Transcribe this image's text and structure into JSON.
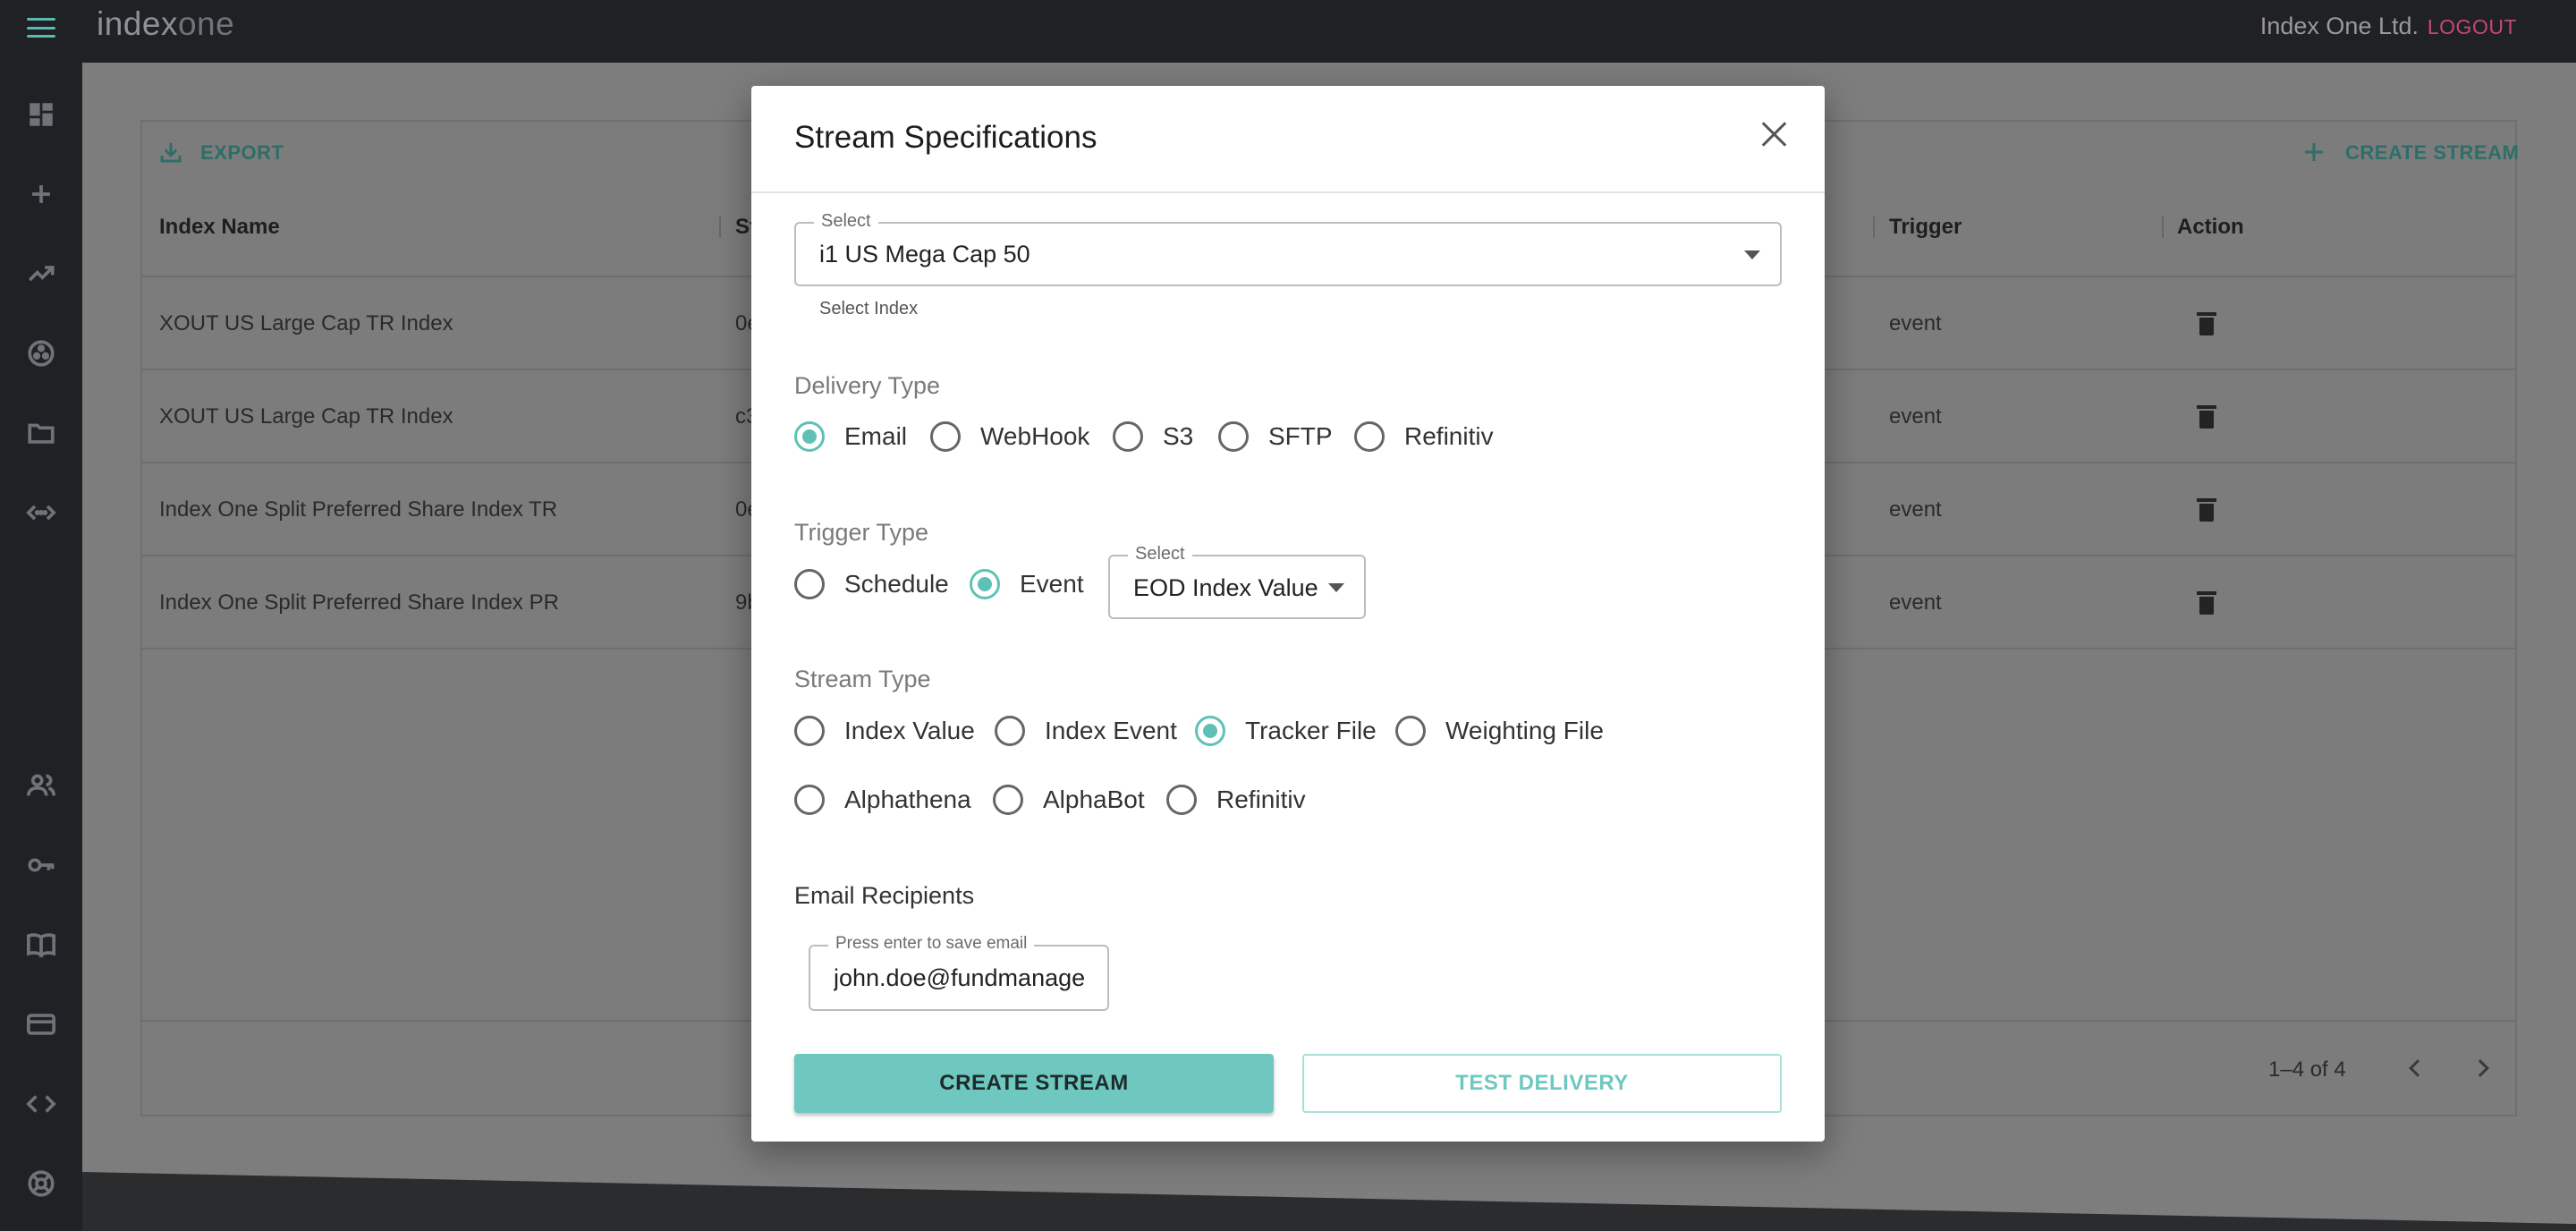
{
  "app": {
    "logo_part1": "index",
    "logo_part2": "one",
    "company": "Index One Ltd.",
    "logout": "LOGOUT"
  },
  "sidebar": {
    "icons": [
      "dashboard-icon",
      "plus-icon",
      "trending-up-icon",
      "hub-icon",
      "folder-icon",
      "api-icon",
      "people-icon",
      "key-icon",
      "book-icon",
      "card-icon",
      "code-icon",
      "support-icon"
    ]
  },
  "table": {
    "export_label": "EXPORT",
    "create_label": "CREATE STREAM",
    "headers": {
      "index_name": "Index Name",
      "stream": "St",
      "trigger": "Trigger",
      "action": "Action"
    },
    "rows": [
      {
        "name": "XOUT US Large Cap TR Index",
        "stream": "0e",
        "trigger": "event"
      },
      {
        "name": "XOUT US Large Cap TR Index",
        "stream": "c3",
        "trigger": "event"
      },
      {
        "name": "Index One Split Preferred Share Index TR",
        "stream": "0e",
        "trigger": "event"
      },
      {
        "name": "Index One Split Preferred Share Index PR",
        "stream": "9b",
        "trigger": "event"
      }
    ],
    "pagination": "1–4 of 4"
  },
  "modal": {
    "title": "Stream Specifications",
    "index_select": {
      "label": "Select",
      "value": "i1 US Mega Cap 50",
      "helper": "Select Index"
    },
    "delivery": {
      "label": "Delivery Type",
      "options": [
        "Email",
        "WebHook",
        "S3",
        "SFTP",
        "Refinitiv"
      ],
      "selected": "Email"
    },
    "trigger": {
      "label": "Trigger Type",
      "options": [
        "Schedule",
        "Event"
      ],
      "selected": "Event",
      "event_select": {
        "label": "Select",
        "value": "EOD Index Value"
      }
    },
    "stream_type": {
      "label": "Stream Type",
      "options": [
        "Index Value",
        "Index Event",
        "Tracker File",
        "Weighting File",
        "Alphathena",
        "AlphaBot",
        "Refinitiv"
      ],
      "selected": "Tracker File"
    },
    "email": {
      "label": "Email Recipients",
      "field_label": "Press enter to save email",
      "value": "john.doe@fundmanage"
    },
    "buttons": {
      "create": "CREATE STREAM",
      "test": "TEST DELIVERY"
    }
  },
  "colors": {
    "accent": "#5fc1b5",
    "button": "#6fc8bf",
    "logout": "#c44a6e",
    "chrome": "#1f2124"
  }
}
